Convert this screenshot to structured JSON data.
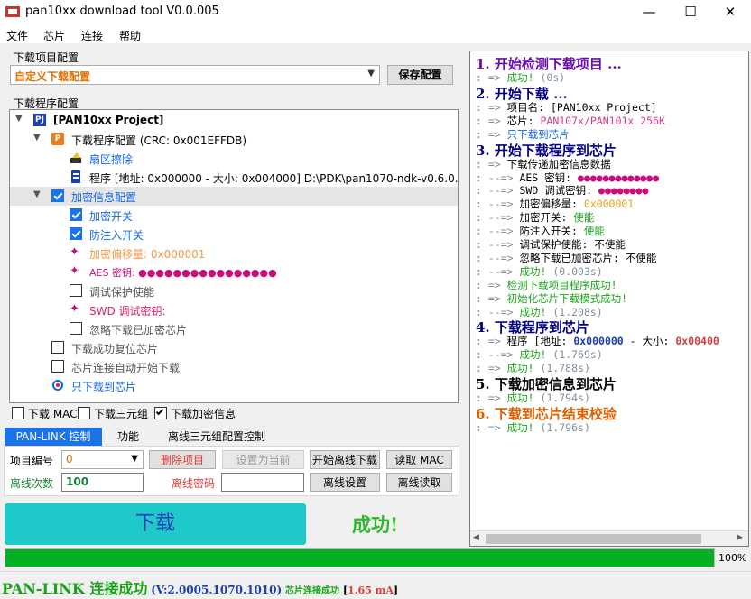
{
  "window": {
    "title": "pan10xx download tool V0.0.005",
    "minimize": "—",
    "maximize": "☐",
    "close": "✕"
  },
  "menu": [
    "文件",
    "芯片",
    "连接",
    "帮助"
  ],
  "project_cfg": {
    "label": "下载项目配置",
    "selected": "自定义下载配置",
    "save_button": "保存配置"
  },
  "program_cfg": {
    "label": "下载程序配置",
    "tree": [
      {
        "text": "[PAN10xx Project]",
        "badge": "PJ"
      },
      {
        "text": "下载程序配置 (CRC: 0x001EFFDB)",
        "badge": "P"
      },
      {
        "text": "扇区擦除"
      },
      {
        "text": "程序 [地址: 0x000000 - 大小: 0x004000] D:\\PDK\\pan1070-ndk-v0.6.0..."
      },
      {
        "text": "加密信息配置"
      },
      {
        "text": "加密开关"
      },
      {
        "text": "防注入开关"
      },
      {
        "text": "加密偏移量: 0x000001"
      },
      {
        "text": "AES 密钥: ●●●●●●●●●●●●●●●●"
      },
      {
        "text": "调试保护使能"
      },
      {
        "text": "SWD 调试密钥:"
      },
      {
        "text": "忽略下载已加密芯片"
      },
      {
        "text": "下载成功复位芯片"
      },
      {
        "text": "芯片连接自动开始下载"
      },
      {
        "text": "只下载到芯片"
      }
    ],
    "options": [
      "下载 MAC",
      "下载三元组",
      "下载加密信息"
    ]
  },
  "tabs": [
    "PAN-LINK 控制",
    "功能",
    "离线三元组配置控制"
  ],
  "panel": {
    "project_no_label": "项目编号",
    "project_no_value": "0",
    "delete_button": "删除项目",
    "set_current_button": "设置为当前",
    "start_offline_button": "开始离线下载",
    "read_mac_button": "读取 MAC",
    "offline_count_label": "离线次数",
    "offline_count_value": "100",
    "offline_pwd_label": "离线密码",
    "offline_pwd_value": "",
    "offline_settings_button": "离线设置",
    "offline_read_button": "离线读取"
  },
  "download_button": "下载",
  "result_text": "成功!",
  "progress": {
    "value": 100,
    "label": "100%"
  },
  "status": {
    "main": "PAN-LINK 连接成功",
    "version": "(V:2.0005.1070.1010)",
    "chip": "芯片连接成功",
    "current_open": "[",
    "current": "1.65 mA",
    "current_close": "]"
  },
  "log": [
    {
      "t": "1.  开始检测下载项目 ...",
      "k": "head",
      "c": "#6a0dad"
    },
    {
      "t": ": => 成功!  (0s)",
      "k": "ok"
    },
    {
      "t": "2.  开始下载 ...",
      "k": "head",
      "c": "#000080"
    },
    {
      "t": ": => 项目名: [PAN10xx Project]",
      "k": "plain"
    },
    {
      "t": ": => 芯片: PAN107x/PAN101x 256K",
      "k": "chip"
    },
    {
      "t": ": => 只下载到芯片",
      "k": "link"
    },
    {
      "t": "3.  开始下载程序到芯片",
      "k": "head",
      "c": "#000080"
    },
    {
      "t": ": => 下载传递加密信息数据",
      "k": "plain"
    },
    {
      "t": ": --=> AES 密钥: ●●●●●●●●●●●●●",
      "k": "dots"
    },
    {
      "t": ": --=> SWD 调试密钥: ●●●●●●●●",
      "k": "dots"
    },
    {
      "t": ": --=> 加密偏移量: 0x000001",
      "k": "off"
    },
    {
      "t": ": --=> 加密开关: 使能",
      "k": "en"
    },
    {
      "t": ": --=> 防注入开关: 使能",
      "k": "en"
    },
    {
      "t": ": --=> 调试保护使能: 不使能",
      "k": "plain"
    },
    {
      "t": ": --=> 忽略下载已加密芯片: 不使能",
      "k": "plain"
    },
    {
      "t": ": --=> 成功!  (0.003s)",
      "k": "ok"
    },
    {
      "t": ": => 检测下载项目程序成功!",
      "k": "green"
    },
    {
      "t": ": => 初始化芯片下载模式成功!",
      "k": "green"
    },
    {
      "t": ": --=> 成功!  (1.208s)",
      "k": "ok"
    },
    {
      "t": "4.  下载程序到芯片",
      "k": "head",
      "c": "#000080"
    },
    {
      "t": ": => 程序 [地址: 0x000000 - 大小: 0x00400",
      "k": "prog"
    },
    {
      "t": ": --=> 成功!  (1.769s)",
      "k": "ok"
    },
    {
      "t": ": => 成功!  (1.788s)",
      "k": "ok"
    },
    {
      "t": "5.  下载加密信息到芯片",
      "k": "head",
      "c": "#000000"
    },
    {
      "t": ": => 成功!  (1.794s)",
      "k": "ok"
    },
    {
      "t": "6.  下载到芯片结束校验",
      "k": "head",
      "c": "#e06000"
    },
    {
      "t": ": => 成功!  (1.796s)",
      "k": "ok"
    }
  ]
}
